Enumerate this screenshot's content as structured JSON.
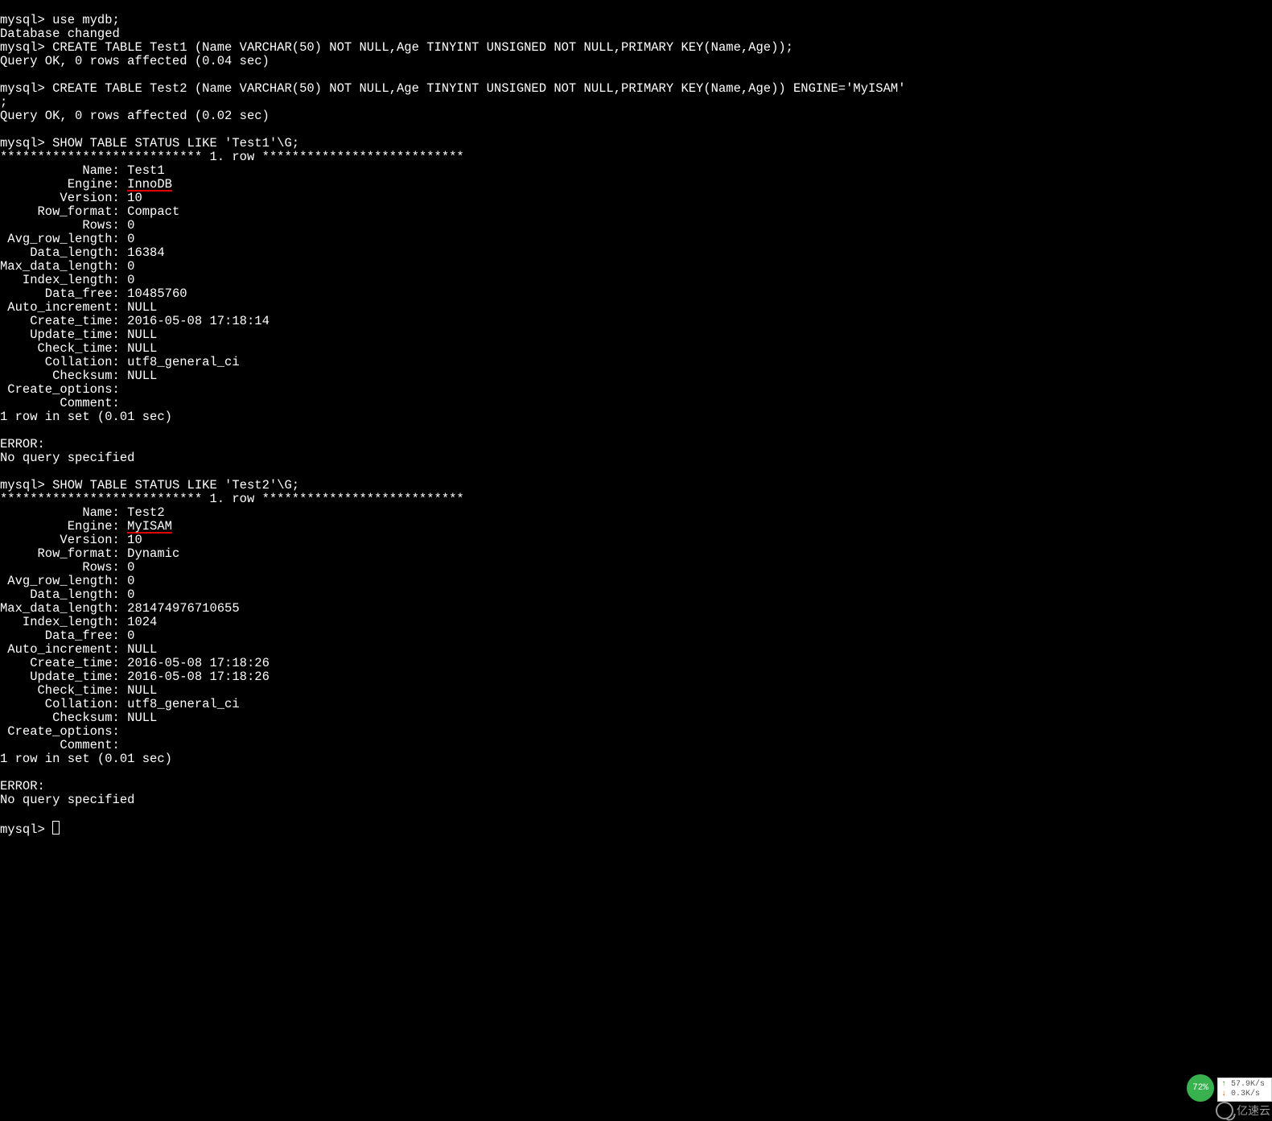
{
  "prompt": "mysql>",
  "cmd_use": "use mydb;",
  "msg_db_changed": "Database changed",
  "cmd_create1": "CREATE TABLE Test1 (Name VARCHAR(50) NOT NULL,Age TINYINT UNSIGNED NOT NULL,PRIMARY KEY(Name,Age));",
  "msg_create1_ok": "Query OK, 0 rows affected (0.04 sec)",
  "cmd_create2": "CREATE TABLE Test2 (Name VARCHAR(50) NOT NULL,Age TINYINT UNSIGNED NOT NULL,PRIMARY KEY(Name,Age)) ENGINE='MyISAM'",
  "cmd_create2_tail": ";",
  "msg_create2_ok": "Query OK, 0 rows affected (0.02 sec)",
  "cmd_status1": "SHOW TABLE STATUS LIKE 'Test1'\\G;",
  "row_sep_left": "***************************",
  "row_sep_label": " 1. row ",
  "row_sep_right": "***************************",
  "status1": {
    "Name": "Test1",
    "Engine": "InnoDB",
    "Version": "10",
    "Row_format": "Compact",
    "Rows": "0",
    "Avg_row_length": "0",
    "Data_length": "16384",
    "Max_data_length": "0",
    "Index_length": "0",
    "Data_free": "10485760",
    "Auto_increment": "NULL",
    "Create_time": "2016-05-08 17:18:14",
    "Update_time": "NULL",
    "Check_time": "NULL",
    "Collation": "utf8_general_ci",
    "Checksum": "NULL",
    "Create_options": "",
    "Comment": ""
  },
  "msg_set1": "1 row in set (0.01 sec)",
  "msg_error": "ERROR:",
  "msg_noquery": "No query specified",
  "cmd_status2": "SHOW TABLE STATUS LIKE 'Test2'\\G;",
  "status2": {
    "Name": "Test2",
    "Engine": "MyISAM",
    "Version": "10",
    "Row_format": "Dynamic",
    "Rows": "0",
    "Avg_row_length": "0",
    "Data_length": "0",
    "Max_data_length": "281474976710655",
    "Index_length": "1024",
    "Data_free": "0",
    "Auto_increment": "NULL",
    "Create_time": "2016-05-08 17:18:26",
    "Update_time": "2016-05-08 17:18:26",
    "Check_time": "NULL",
    "Collation": "utf8_general_ci",
    "Checksum": "NULL",
    "Create_options": "",
    "Comment": ""
  },
  "msg_set2": "1 row in set (0.01 sec)",
  "labels": {
    "Name": "           Name: ",
    "Engine": "         Engine: ",
    "Version": "        Version: ",
    "Row_format": "     Row_format: ",
    "Rows": "           Rows: ",
    "Avg_row_length": " Avg_row_length: ",
    "Data_length": "    Data_length: ",
    "Max_data_length": "Max_data_length: ",
    "Index_length": "   Index_length: ",
    "Data_free": "      Data_free: ",
    "Auto_increment": " Auto_increment: ",
    "Create_time": "    Create_time: ",
    "Update_time": "    Update_time: ",
    "Check_time": "     Check_time: ",
    "Collation": "      Collation: ",
    "Checksum": "       Checksum: ",
    "Create_options": " Create_options:",
    "Comment": "        Comment:"
  },
  "widgets": {
    "percent": "72%",
    "net_up": "57.9K/s",
    "net_dn": "0.3K/s",
    "watermark": "亿速云"
  }
}
